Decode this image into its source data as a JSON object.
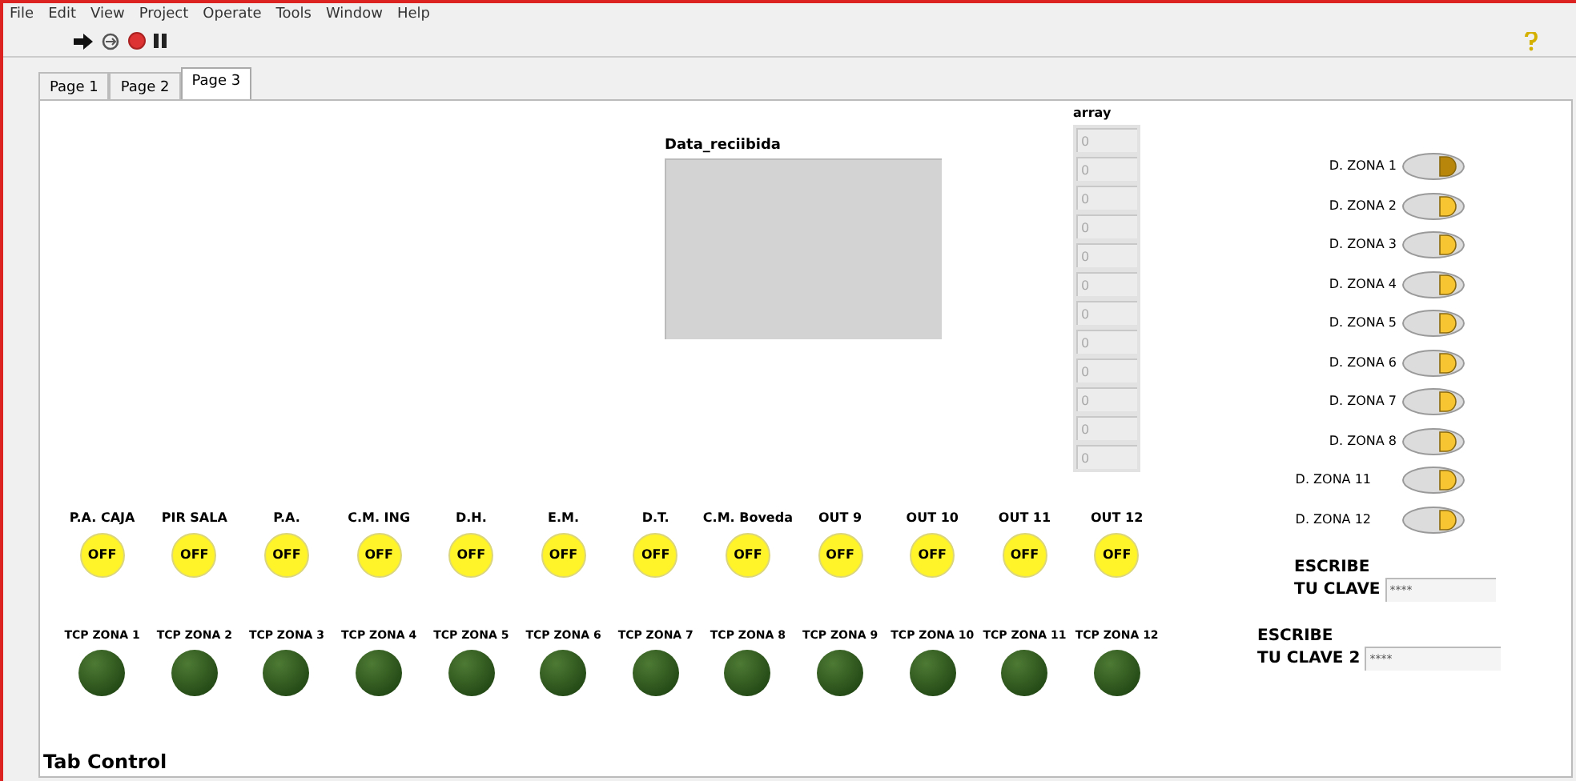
{
  "menu": [
    "File",
    "Edit",
    "View",
    "Project",
    "Operate",
    "Tools",
    "Window",
    "Help"
  ],
  "tabs": [
    {
      "label": "Page 1",
      "selected": false
    },
    {
      "label": "Page 2",
      "selected": false
    },
    {
      "label": "Page 3",
      "selected": true
    }
  ],
  "data_display": {
    "label": "Data_reciibida"
  },
  "array": {
    "label": "array",
    "values": [
      "0",
      "0",
      "0",
      "0",
      "0",
      "0",
      "0",
      "0",
      "0",
      "0",
      "0",
      "0"
    ]
  },
  "buttons": [
    {
      "label": "P.A. CAJA",
      "text": "OFF",
      "on": false
    },
    {
      "label": "PIR SALA",
      "text": "OFF",
      "on": false
    },
    {
      "label": "P.A.",
      "text": "OFF",
      "on": false
    },
    {
      "label": "C.M. ING",
      "text": "OFF",
      "on": false
    },
    {
      "label": "D.H.",
      "text": "OFF",
      "on": false
    },
    {
      "label": "E.M.",
      "text": "OFF",
      "on": false
    },
    {
      "label": "D.T.",
      "text": "OFF",
      "on": false
    },
    {
      "label": "C.M. Boveda",
      "text": "OFF",
      "on": false
    },
    {
      "label": "OUT 9",
      "text": "OFF",
      "on": false
    },
    {
      "label": "OUT 10",
      "text": "OFF",
      "on": false
    },
    {
      "label": "OUT 11",
      "text": "OFF",
      "on": false
    },
    {
      "label": "OUT 12",
      "text": "OFF",
      "on": false
    }
  ],
  "leds": [
    {
      "label": "TCP ZONA 1",
      "on": false
    },
    {
      "label": "TCP ZONA 2",
      "on": false
    },
    {
      "label": "TCP ZONA 3",
      "on": false
    },
    {
      "label": "TCP ZONA 4",
      "on": false
    },
    {
      "label": "TCP ZONA 5",
      "on": false
    },
    {
      "label": "TCP ZONA 6",
      "on": false
    },
    {
      "label": "TCP ZONA 7",
      "on": false
    },
    {
      "label": "TCP ZONA 8",
      "on": false
    },
    {
      "label": "TCP ZONA 9",
      "on": false
    },
    {
      "label": "TCP ZONA 10",
      "on": false
    },
    {
      "label": "TCP ZONA 11",
      "on": false
    },
    {
      "label": "TCP ZONA 12",
      "on": false
    }
  ],
  "zones": [
    {
      "label": "D. ZONA 1",
      "on": true
    },
    {
      "label": "D. ZONA 2",
      "on": false
    },
    {
      "label": "D. ZONA 3",
      "on": false
    },
    {
      "label": "D. ZONA 4",
      "on": false
    },
    {
      "label": "D. ZONA 5",
      "on": false
    },
    {
      "label": "D. ZONA 6",
      "on": false
    },
    {
      "label": "D. ZONA 7",
      "on": false
    },
    {
      "label": "D. ZONA 8",
      "on": false
    },
    {
      "label": "D. ZONA  11",
      "on": false
    },
    {
      "label": "D. ZONA  12",
      "on": false
    }
  ],
  "passwords": [
    {
      "label_1": "ESCRIBE",
      "label_2": "TU CLAVE",
      "value": "****"
    },
    {
      "label_1": "ESCRIBE",
      "label_2": "TU CLAVE 2",
      "value": "****"
    }
  ],
  "tab_control_label": "Tab Control"
}
